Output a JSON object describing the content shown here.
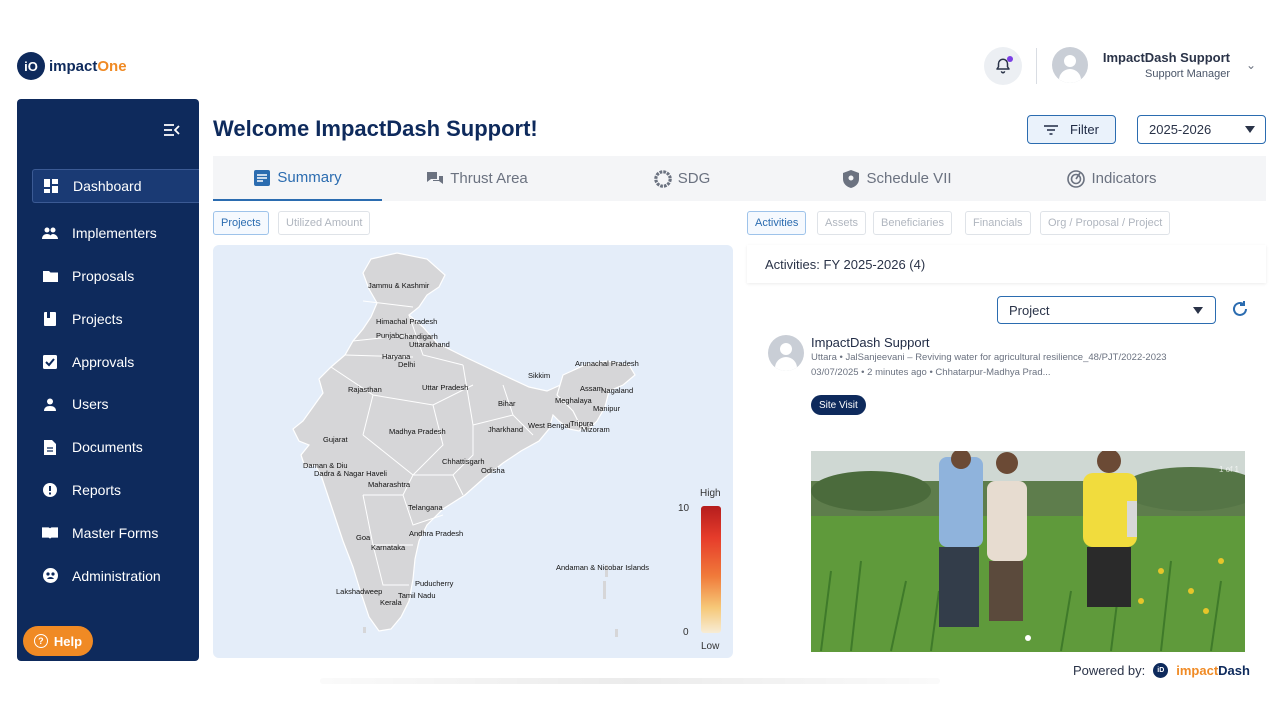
{
  "brand": {
    "logo_mark": "iO",
    "logo_text_a": "impact",
    "logo_text_b": "One"
  },
  "header": {
    "user_name": "ImpactDash Support",
    "user_role": "Support Manager",
    "notification_icon": "bell-icon",
    "accent_color": "#f08a24",
    "primary_color": "#0e2a5c"
  },
  "sidebar": {
    "items": [
      {
        "label": "Dashboard",
        "icon": "dashboard-icon",
        "active": true
      },
      {
        "label": "Implementers",
        "icon": "people-icon"
      },
      {
        "label": "Proposals",
        "icon": "folder-icon"
      },
      {
        "label": "Projects",
        "icon": "book-icon"
      },
      {
        "label": "Approvals",
        "icon": "checkbox-icon"
      },
      {
        "label": "Users",
        "icon": "user-icon"
      },
      {
        "label": "Documents",
        "icon": "document-icon"
      },
      {
        "label": "Reports",
        "icon": "alert-circle-icon"
      },
      {
        "label": "Master Forms",
        "icon": "open-book-icon"
      },
      {
        "label": "Administration",
        "icon": "admin-icon"
      }
    ],
    "help_label": "Help"
  },
  "main": {
    "welcome": "Welcome ImpactDash Support!",
    "filter_label": "Filter",
    "year_selected": "2025-2026",
    "tabs": [
      {
        "label": "Summary",
        "active": true
      },
      {
        "label": "Thrust Area"
      },
      {
        "label": "SDG"
      },
      {
        "label": "Schedule VII"
      },
      {
        "label": "Indicators"
      }
    ],
    "left_chips": [
      "Projects",
      "Utilized Amount"
    ],
    "right_chips": [
      "Activities",
      "Assets",
      "Beneficiaries",
      "Financials",
      "Org / Proposal / Project"
    ]
  },
  "map": {
    "states": [
      "Jammu & Kashmir",
      "Himachal Pradesh",
      "Punjab",
      "Chandigarh",
      "Uttarakhand",
      "Haryana",
      "Delhi",
      "Rajasthan",
      "Uttar Pradesh",
      "Sikkim",
      "Arunachal Pradesh",
      "Assam",
      "Nagaland",
      "Meghalaya",
      "Manipur",
      "Bihar",
      "Jharkhand",
      "West Bengal",
      "Tripura",
      "Mizoram",
      "Gujarat",
      "Madhya Pradesh",
      "Daman & Diu",
      "Dadra & Nagar Haveli",
      "Chhattisgarh",
      "Odisha",
      "Maharashtra",
      "Telangana",
      "Goa",
      "Andhra Pradesh",
      "Karnataka",
      "Andaman & Nicobar Islands",
      "Puducherry",
      "Lakshadweep",
      "Tamil Nadu",
      "Kerala"
    ],
    "legend": {
      "high_label": "High",
      "low_label": "Low",
      "max": "10",
      "min": "0"
    }
  },
  "activities": {
    "header": "Activities: FY 2025-2026 (4)",
    "filter_selected": "Project",
    "post": {
      "author": "ImpactDash Support",
      "description": "Uttara • JalSanjeevani – Reviving water for agricultural resilience_48/PJT/2022-2023",
      "meta": "03/07/2025 • 2 minutes ago • Chhatarpur-Madhya Prad...",
      "tag": "Site Visit",
      "photo_counter": "1 of 1"
    }
  },
  "footer": {
    "powered_by": "Powered by:",
    "brand_a": "impact",
    "brand_b": "Dash",
    "brand_mark": "iD"
  }
}
